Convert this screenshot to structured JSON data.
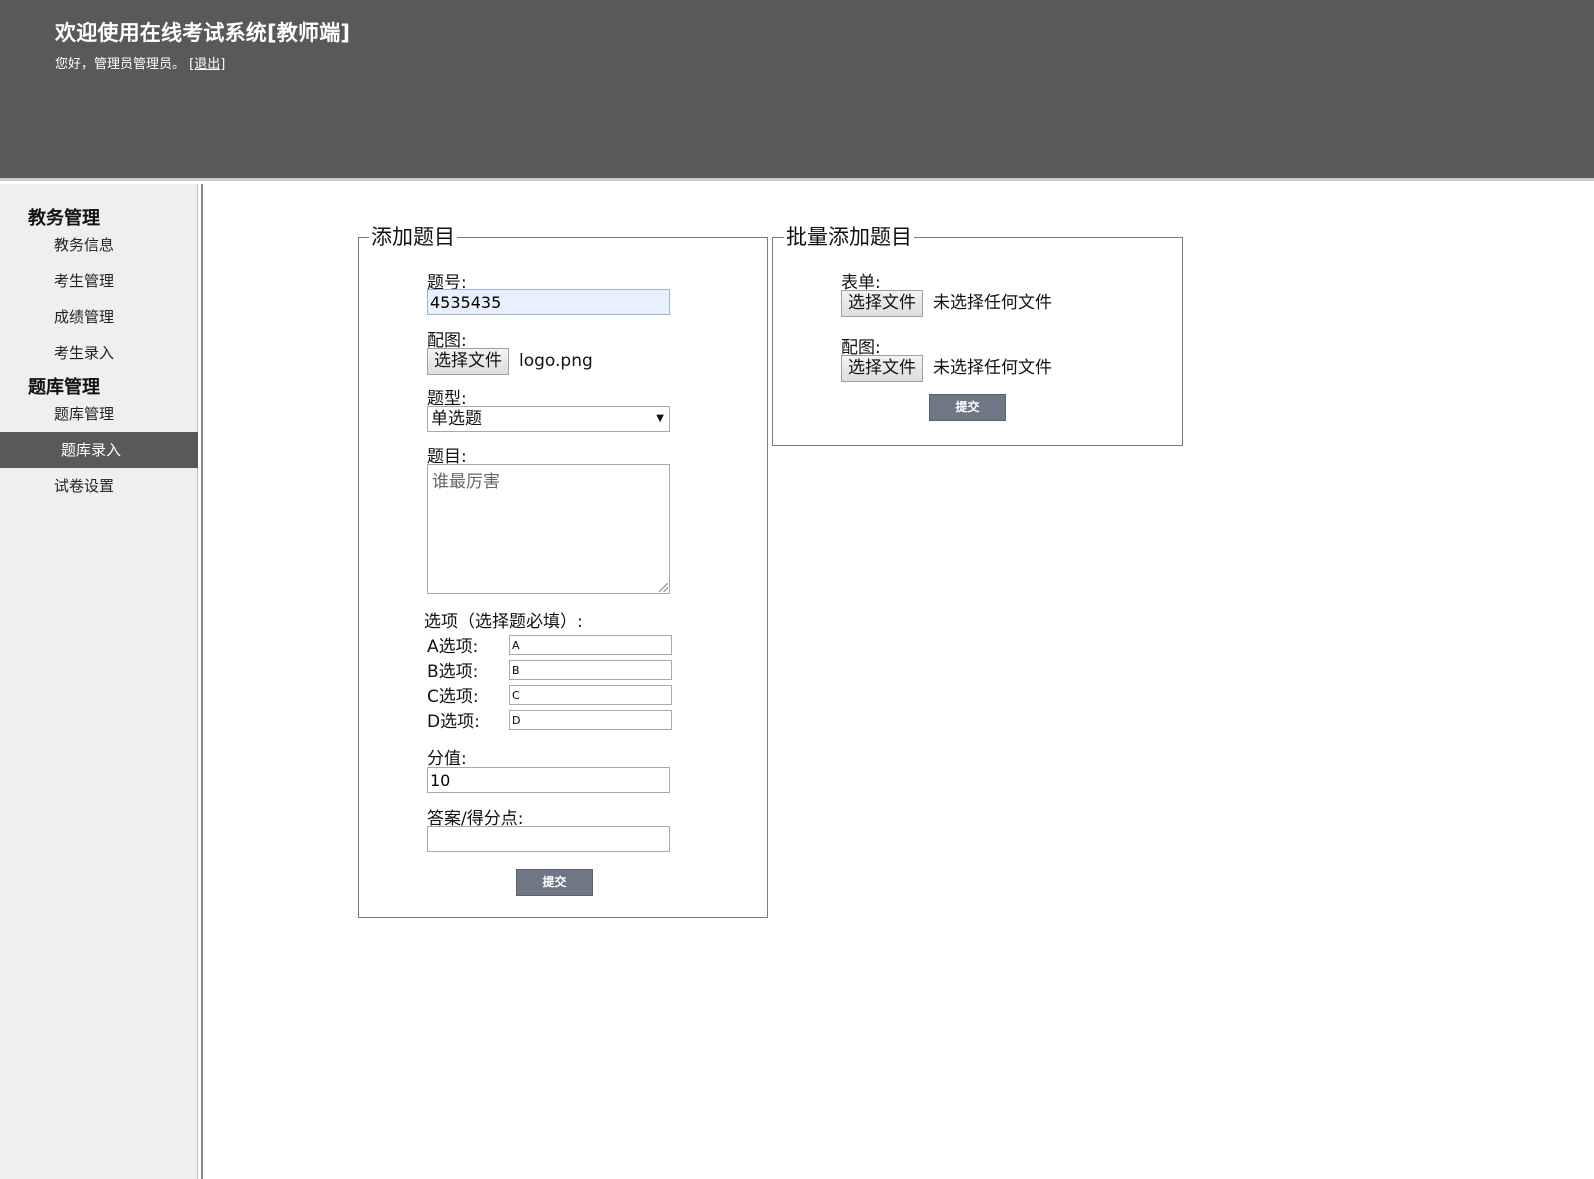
{
  "header": {
    "title": "欢迎使用在线考试系统[教师端]",
    "greeting": "您好，管理员管理员。",
    "logout_label": "[退出]"
  },
  "sidebar": {
    "groups": [
      {
        "title": "教务管理",
        "items": [
          {
            "label": "教务信息"
          },
          {
            "label": "考生管理"
          },
          {
            "label": "成绩管理"
          },
          {
            "label": "考生录入"
          }
        ]
      },
      {
        "title": "题库管理",
        "items": [
          {
            "label": "题库管理"
          },
          {
            "label": "题库录入",
            "active": true
          },
          {
            "label": "试卷设置"
          }
        ]
      }
    ]
  },
  "add_form": {
    "legend": "添加题目",
    "number_label": "题号:",
    "number_value": "4535435",
    "image_label": "配图:",
    "image_button": "选择文件",
    "image_file": "logo.png",
    "type_label": "题型:",
    "type_value": "单选题",
    "question_label": "题目:",
    "question_value": "谁最厉害",
    "options_label": "选项（选择题必填）:",
    "options": [
      {
        "label": "A选项:",
        "value": "A"
      },
      {
        "label": "B选项:",
        "value": "B"
      },
      {
        "label": "C选项:",
        "value": "C"
      },
      {
        "label": "D选项:",
        "value": "D"
      }
    ],
    "score_label": "分值:",
    "score_value": "10",
    "answer_label": "答案/得分点:",
    "answer_value": "",
    "submit_label": "提交"
  },
  "batch_form": {
    "legend": "批量添加题目",
    "sheet_label": "表单:",
    "sheet_button": "选择文件",
    "sheet_file": "未选择任何文件",
    "image_label": "配图:",
    "image_button": "选择文件",
    "image_file": "未选择任何文件",
    "submit_label": "提交"
  },
  "colors": {
    "header_bg": "#595959",
    "sidebar_bg": "#efefef",
    "active_item_bg": "#595959",
    "submit_bg": "#6f7784"
  }
}
